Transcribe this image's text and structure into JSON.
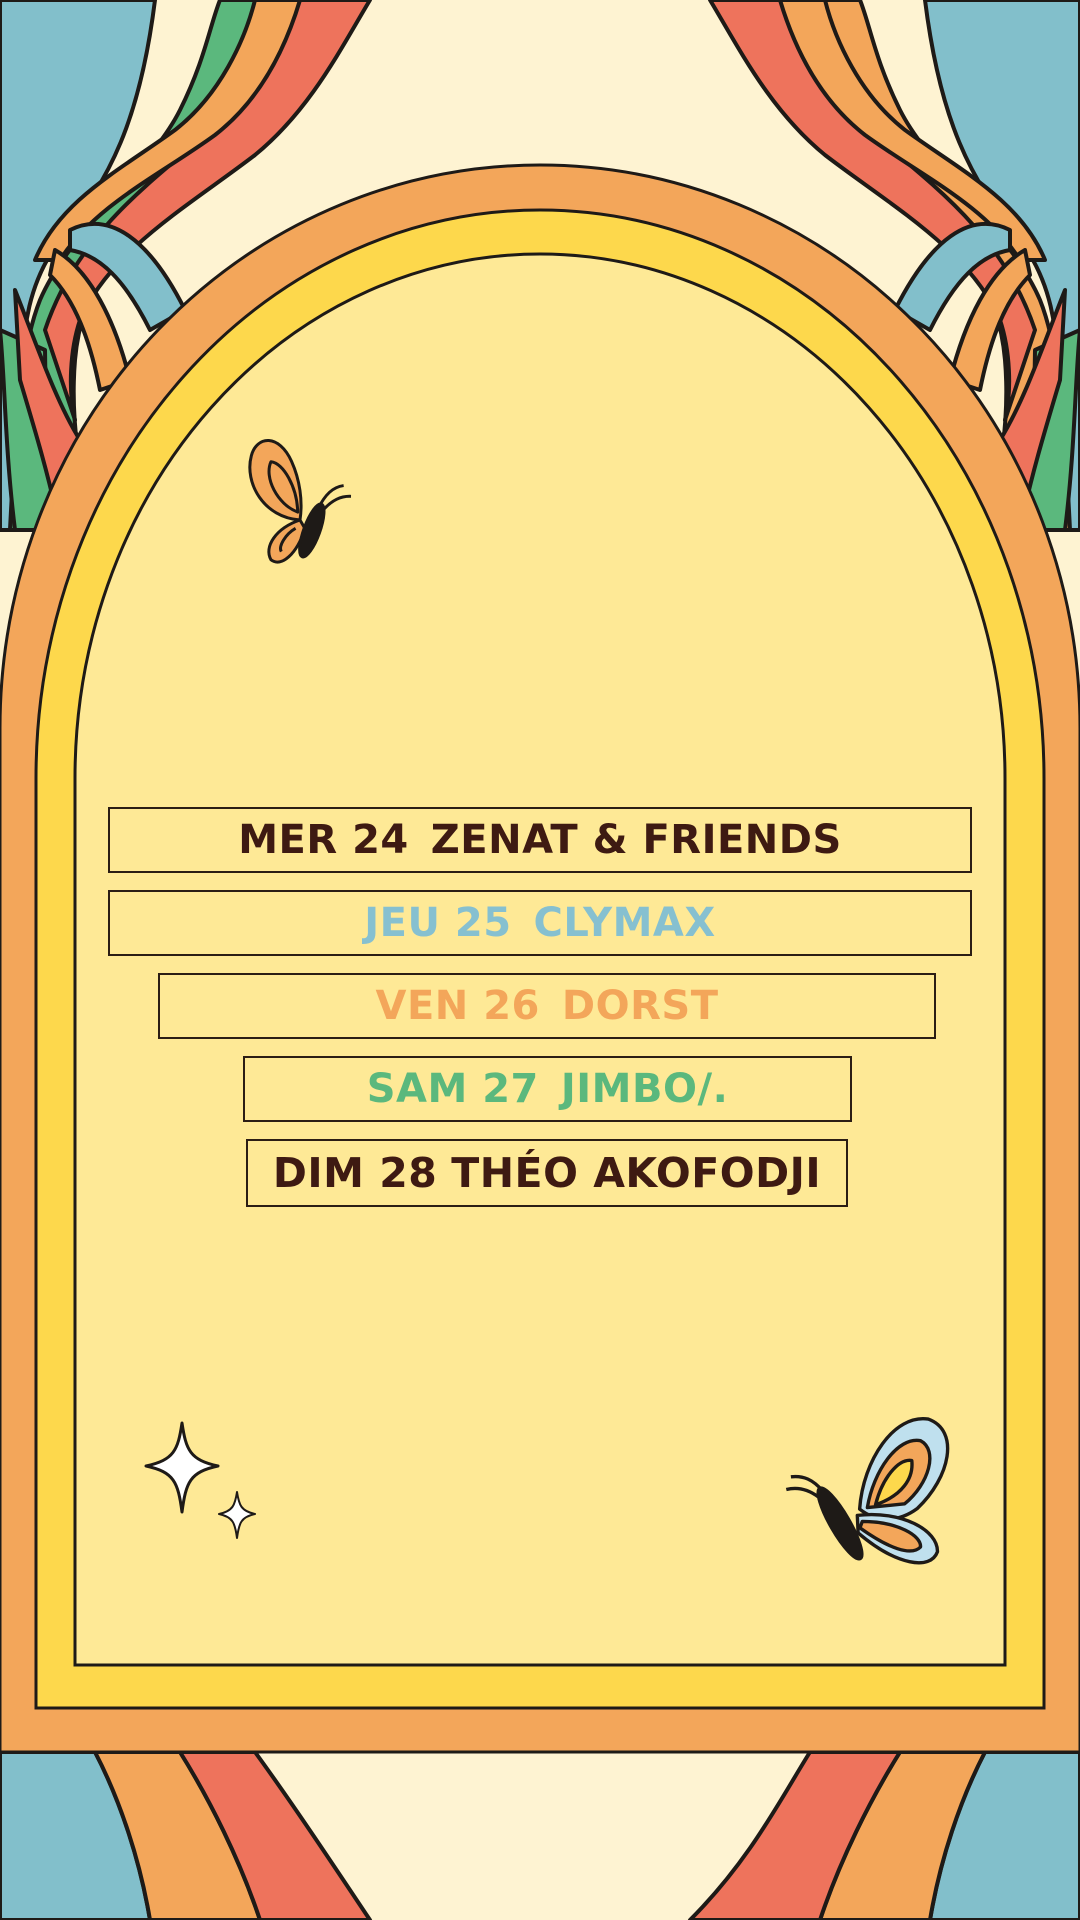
{
  "colors": {
    "background": "#FEF3D2",
    "arch_outer": "#F3A65A",
    "arch_middle": "#FDD84C",
    "arch_inner": "#FEE996",
    "stripe_blue": "#82BFCB",
    "stripe_orange": "#F3A65A",
    "stripe_red": "#EE735C",
    "stripe_green": "#5BB87D",
    "text_dark": "#3E1A12",
    "text_blue": "#86C0D0",
    "text_orange": "#F3A65A",
    "text_green": "#5BB87D"
  },
  "events": [
    {
      "day": "MER 24",
      "artist": "ZENAT & FRIENDS",
      "color": "#3E1A12"
    },
    {
      "day": "JEU 25",
      "artist": "CLYMAX",
      "color": "#86C0D0"
    },
    {
      "day": "VEN 26",
      "artist": "DORST",
      "color": "#F3A65A"
    },
    {
      "day": "SAM 27",
      "artist": "JIMBO/.",
      "color": "#5BB87D"
    },
    {
      "day": "DIM 28",
      "artist": "THÉO AKOFODJI",
      "color": "#3E1A12"
    }
  ],
  "decorations": {
    "top_butterfly": "butterfly-icon",
    "bottom_butterfly": "butterfly-icon",
    "sparkles": "sparkle-icon"
  }
}
